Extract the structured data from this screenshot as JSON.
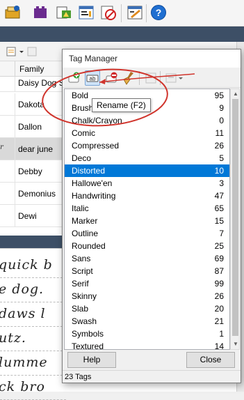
{
  "background": {
    "table_header": "Family",
    "rows": [
      {
        "name": "Daisy Dog So",
        "left": ""
      },
      {
        "name": "Dakota",
        "left": ""
      },
      {
        "name": "Dallon",
        "left": ""
      },
      {
        "name": "dear june",
        "left": "r"
      },
      {
        "name": "Debby",
        "left": ""
      },
      {
        "name": "Demonius",
        "left": ""
      },
      {
        "name": "Dewi",
        "left": ""
      }
    ],
    "preview_lines": [
      "quick b",
      "e dog.",
      "daws l",
      "utz.",
      "lumme",
      "ck bro"
    ]
  },
  "dialog": {
    "title": "Tag Manager",
    "tooltip": "Rename (F2)",
    "tags": [
      {
        "name": "Bold",
        "count": "95"
      },
      {
        "name": "Brush",
        "count": "9"
      },
      {
        "name": "Chalk/Crayon",
        "count": "0"
      },
      {
        "name": "Comic",
        "count": "11"
      },
      {
        "name": "Compressed",
        "count": "26"
      },
      {
        "name": "Deco",
        "count": "5"
      },
      {
        "name": "Distorted",
        "count": "10"
      },
      {
        "name": "Hallowe'en",
        "count": "3"
      },
      {
        "name": "Handwriting",
        "count": "47"
      },
      {
        "name": "Italic",
        "count": "65"
      },
      {
        "name": "Marker",
        "count": "15"
      },
      {
        "name": "Outline",
        "count": "7"
      },
      {
        "name": "Rounded",
        "count": "25"
      },
      {
        "name": "Sans",
        "count": "69"
      },
      {
        "name": "Script",
        "count": "87"
      },
      {
        "name": "Serif",
        "count": "99"
      },
      {
        "name": "Skinny",
        "count": "26"
      },
      {
        "name": "Slab",
        "count": "20"
      },
      {
        "name": "Swash",
        "count": "21"
      },
      {
        "name": "Symbols",
        "count": "1"
      },
      {
        "name": "Textured",
        "count": "14"
      }
    ],
    "selected_tag": "Distorted",
    "help_label": "Help",
    "close_label": "Close",
    "status": "23 Tags"
  },
  "colors": {
    "selection": "#0078d7",
    "annotation": "#d0342c",
    "header_band": "#3d4f66"
  }
}
